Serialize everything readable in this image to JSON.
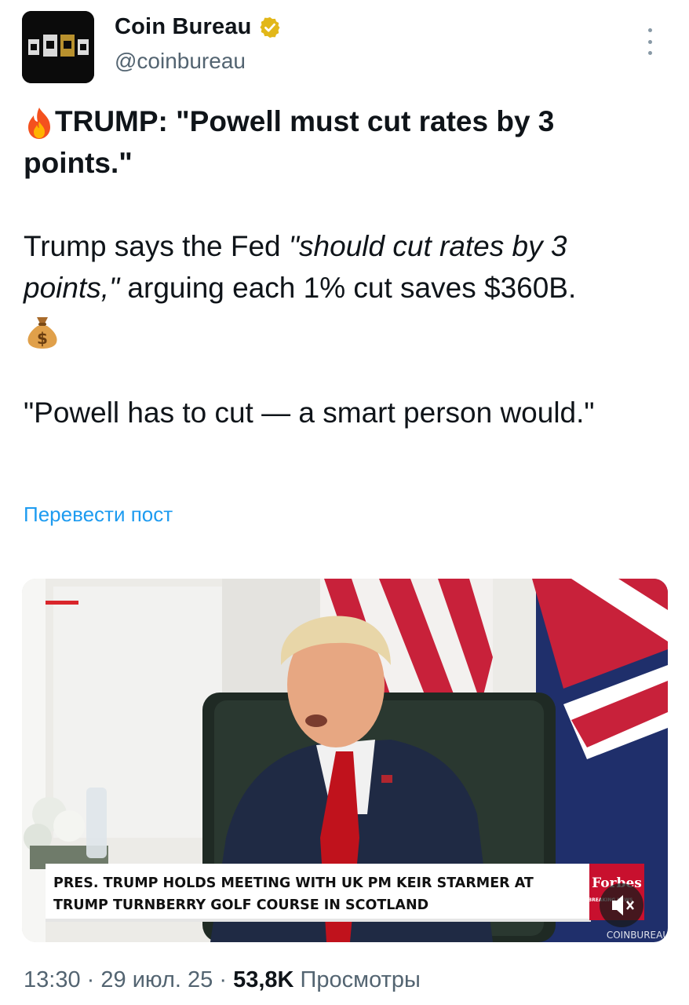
{
  "account": {
    "display_name": "Coin Bureau",
    "handle": "@coinbureau",
    "verified_icon": "verified-badge-gold",
    "avatar_icon": "coin-bureau-logo"
  },
  "post": {
    "title_emoji": "fire-emoji",
    "title": "TRUMP: \"Powell must cut rates by 3 points.\"",
    "body_plain_1": "Trump says the Fed ",
    "body_italic": "\"should cut rates by 3 points,\"",
    "body_plain_2": " arguing each 1% cut saves $360B.",
    "body_emoji": "money-bag-emoji",
    "quote": "\"Powell has to cut — a smart person would.\""
  },
  "translate_label": "Перевести пост",
  "media": {
    "lower_third_line1": "PRES. TRUMP HOLDS MEETING WITH UK PM KEIR STARMER AT",
    "lower_third_line2": "TRUMP TURNBERRY GOLF COURSE IN SCOTLAND",
    "brand_logo": "Forbes",
    "brand_sub": "BREAKING NEWS",
    "watermark": "COINBUREAU",
    "mute_icon": "speaker-muted-icon"
  },
  "meta": {
    "time": "13:30",
    "date": "29 июл. 25",
    "views_count": "53,8K",
    "views_label": "Просмотры",
    "separator": "·"
  },
  "colors": {
    "link": "#1d9bf0",
    "secondary_text": "#536471",
    "primary_text": "#0f1419",
    "verified": "#e2b719",
    "forbes_red": "#c8102e"
  }
}
